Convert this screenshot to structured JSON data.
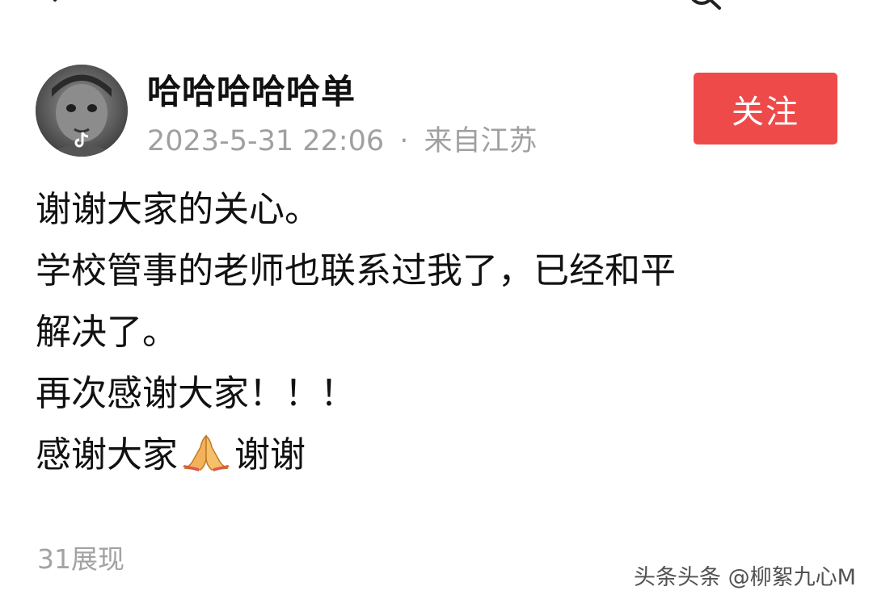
{
  "header": {
    "back_icon": "back-arrow-icon",
    "search_icon": "search-icon"
  },
  "author": {
    "name": "哈哈哈哈哈单",
    "date": "2023-5-31 22:06",
    "separator": "·",
    "location": "来自江苏",
    "avatar_badge_icon": "tiktok-logo-icon"
  },
  "follow_button": {
    "label": "关注",
    "color": "#ee4a4a"
  },
  "post": {
    "lines": [
      "谢谢大家的关心。",
      "学校管事的老师也联系过我了，已经和平",
      "解决了。",
      "再次感谢大家！！！"
    ],
    "last_line_before_emoji": "感谢大家",
    "emoji_icon": "folded-hands-icon",
    "last_line_after_emoji": "谢谢"
  },
  "views": {
    "label": "31展现"
  },
  "watermark": {
    "text": "头条头条 @柳絮九心M"
  }
}
